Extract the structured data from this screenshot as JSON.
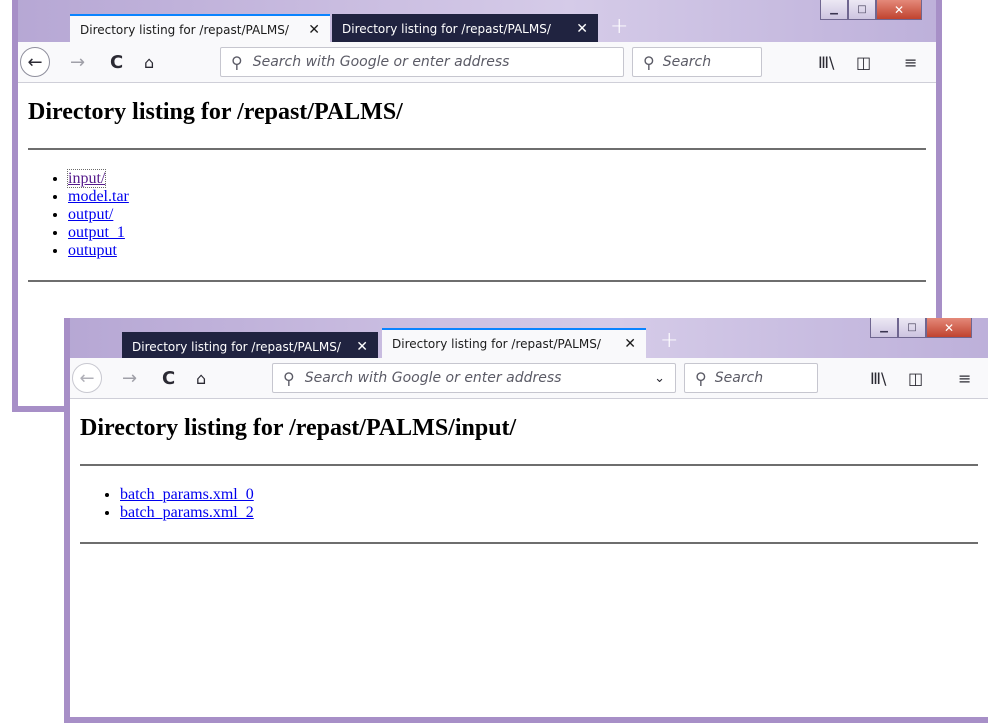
{
  "window1": {
    "tabs": [
      {
        "label": "Directory listing for /repast/PALMS/",
        "active": true
      },
      {
        "label": "Directory listing for /repast/PALMS/",
        "active": false
      }
    ],
    "new_tab": "+",
    "url_placeholder": "Search with Google or enter address",
    "search_placeholder": "Search",
    "heading": "Directory listing for /repast/PALMS/",
    "links": [
      "input/",
      "model.tar",
      "output/",
      "output_1",
      "outuput"
    ]
  },
  "window2": {
    "tabs": [
      {
        "label": "Directory listing for /repast/PALMS/",
        "active": false
      },
      {
        "label": "Directory listing for /repast/PALMS/",
        "active": true
      }
    ],
    "new_tab": "+",
    "url_placeholder": "Search with Google or enter address",
    "search_placeholder": "Search",
    "heading": "Directory listing for /repast/PALMS/input/",
    "links": [
      "batch_params.xml_0",
      "batch_params.xml_2"
    ]
  },
  "icons": {
    "back": "←",
    "forward": "→",
    "reload": "C",
    "home": "⌂",
    "search": "⚲",
    "dropdown": "⌄",
    "library": "Ⅲ\\",
    "sidebar": "◫",
    "menu": "≡",
    "close": "✕",
    "minimize": "▁",
    "maximize": "□",
    "win_close": "✕"
  },
  "colors": {
    "tab_accent": "#0a84ff",
    "inactive_tab": "#202340",
    "link": "#0000ee",
    "visited_link": "#551a8b",
    "frame": "#a78fc7"
  }
}
